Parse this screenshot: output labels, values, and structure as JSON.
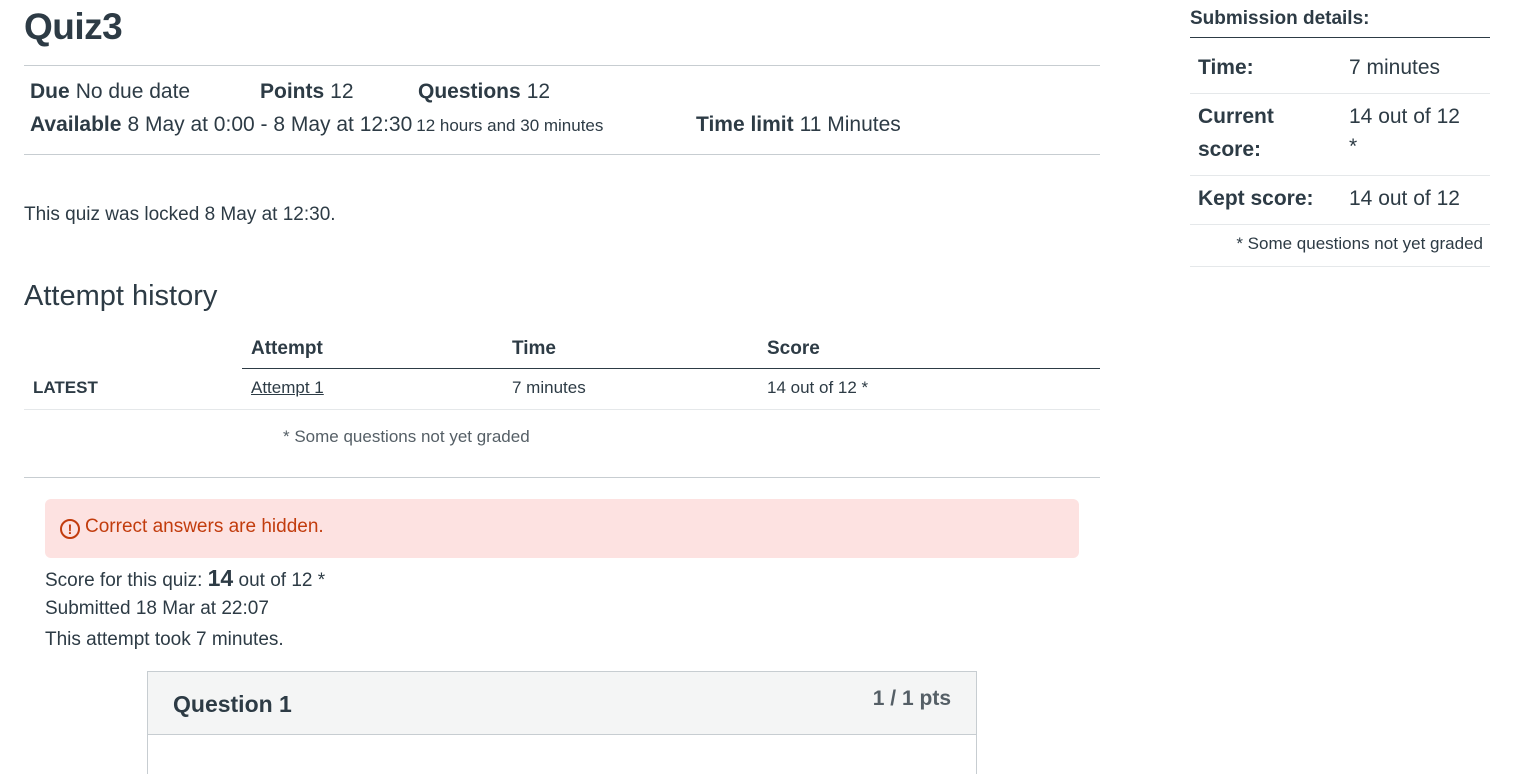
{
  "quiz": {
    "title": "Quiz3"
  },
  "meta": {
    "due_label": "Due",
    "due_value": "No due date",
    "points_label": "Points",
    "points_value": "12",
    "questions_label": "Questions",
    "questions_value": "12",
    "available_label": "Available",
    "available_value": "8 May at 0:00 - 8 May at 12:30",
    "available_duration": "12 hours and 30 minutes",
    "time_limit_label": "Time limit",
    "time_limit_value": "11 Minutes"
  },
  "locked_message": "This quiz was locked 8 May at 12:30.",
  "attempt_history": {
    "heading": "Attempt history",
    "columns": [
      "Attempt",
      "Time",
      "Score"
    ],
    "rows": [
      {
        "tag": "LATEST",
        "attempt": "Attempt 1",
        "time": "7 minutes",
        "score": "14 out of 12 *"
      }
    ],
    "footnote": "* Some questions not yet graded"
  },
  "alert": {
    "icon": "exclamation-circle-icon",
    "text": "Correct answers are hidden."
  },
  "summary": {
    "score_prefix": "Score for this quiz: ",
    "score_value": "14",
    "score_suffix": " out of 12 *",
    "submitted": "Submitted 18 Mar at 22:07",
    "duration": "This attempt took 7 minutes."
  },
  "question": {
    "title": "Question 1",
    "points": "1 / 1 pts"
  },
  "sidebar": {
    "title": "Submission details:",
    "time_label": "Time:",
    "time_value": "7 minutes",
    "current_label_1": "Current",
    "current_label_2": "score:",
    "current_value_1": "14 out of 12",
    "current_value_2": "*",
    "kept_label": "Kept score:",
    "kept_value": "14 out of 12",
    "note": "* Some questions not yet graded"
  },
  "colors": {
    "text": "#2d3b45",
    "alert_bg": "#fde2e1",
    "alert_text": "#c23c0d",
    "divider": "#c7cdd1"
  }
}
